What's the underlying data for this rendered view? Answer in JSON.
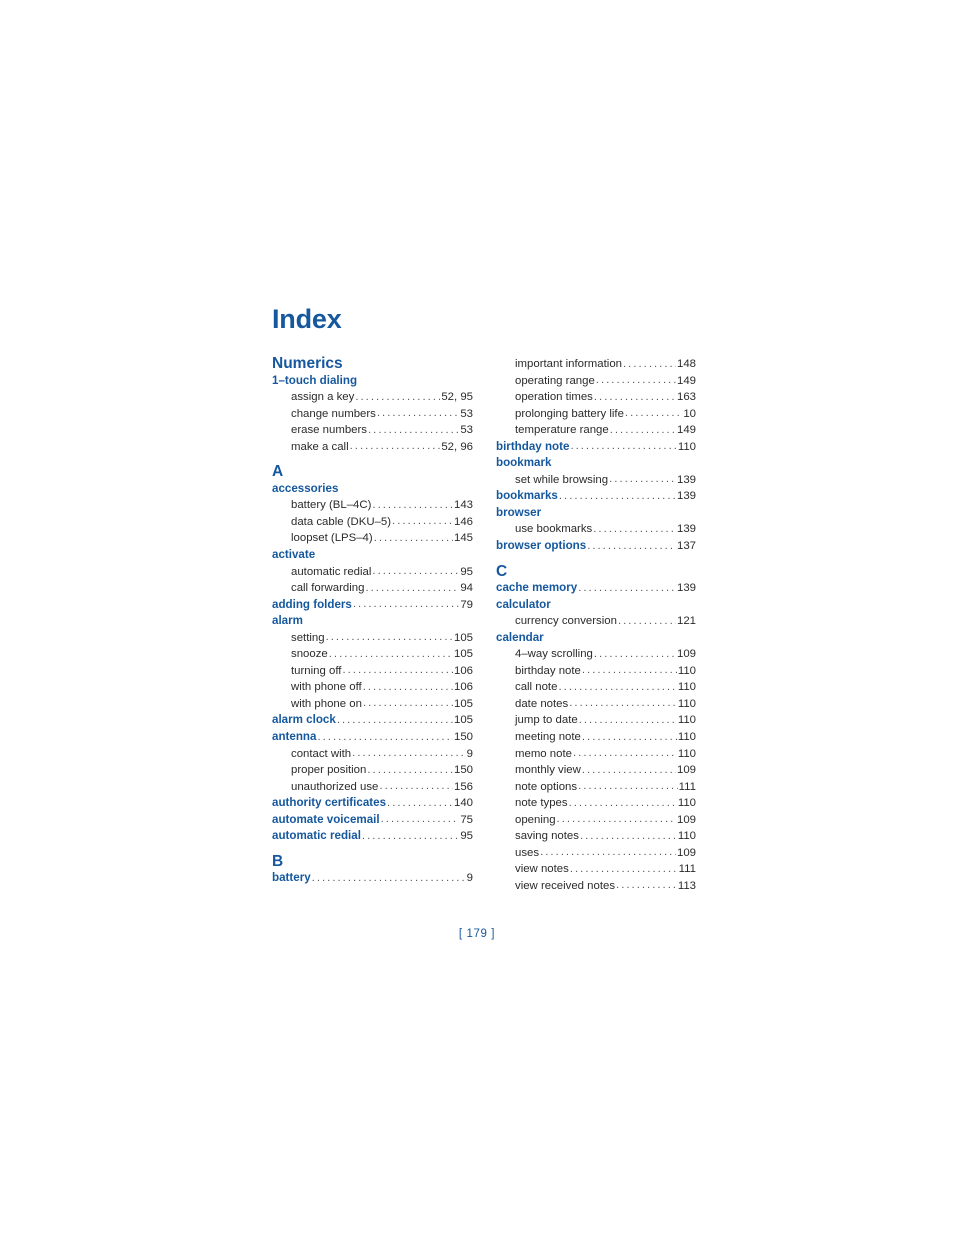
{
  "document": {
    "title": "Index",
    "folio": "[ 179 ]"
  },
  "columns": {
    "left": [
      {
        "type": "letter",
        "label": "Numerics"
      },
      {
        "type": "main",
        "label": "1–touch dialing",
        "page": ""
      },
      {
        "type": "sub",
        "label": "assign a key",
        "page": "52, 95"
      },
      {
        "type": "sub",
        "label": "change numbers",
        "page": "53"
      },
      {
        "type": "sub",
        "label": "erase numbers",
        "page": "53"
      },
      {
        "type": "sub",
        "label": "make a call",
        "page": "52, 96"
      },
      {
        "type": "letter",
        "label": "A"
      },
      {
        "type": "main",
        "label": "accessories",
        "page": ""
      },
      {
        "type": "sub",
        "label": "battery (BL–4C)",
        "page": "143"
      },
      {
        "type": "sub",
        "label": "data cable (DKU–5)",
        "page": "146"
      },
      {
        "type": "sub",
        "label": "loopset (LPS–4)",
        "page": "145"
      },
      {
        "type": "main",
        "label": "activate",
        "page": ""
      },
      {
        "type": "sub",
        "label": "automatic redial",
        "page": "95"
      },
      {
        "type": "sub",
        "label": "call forwarding",
        "page": "94"
      },
      {
        "type": "main",
        "label": "adding folders",
        "page": "79"
      },
      {
        "type": "main",
        "label": "alarm",
        "page": ""
      },
      {
        "type": "sub",
        "label": "setting",
        "page": "105"
      },
      {
        "type": "sub",
        "label": "snooze",
        "page": "105"
      },
      {
        "type": "sub",
        "label": "turning off",
        "page": "106"
      },
      {
        "type": "sub",
        "label": "with phone off",
        "page": "106"
      },
      {
        "type": "sub",
        "label": "with phone on",
        "page": "105"
      },
      {
        "type": "main",
        "label": "alarm clock",
        "page": "105"
      },
      {
        "type": "main",
        "label": "antenna",
        "page": "150"
      },
      {
        "type": "sub",
        "label": "contact with",
        "page": "9"
      },
      {
        "type": "sub",
        "label": "proper position",
        "page": "150"
      },
      {
        "type": "sub",
        "label": "unauthorized use",
        "page": "156"
      },
      {
        "type": "main",
        "label": "authority certificates",
        "page": "140"
      },
      {
        "type": "main",
        "label": "automate voicemail",
        "page": "75"
      },
      {
        "type": "main",
        "label": "automatic redial",
        "page": "95"
      },
      {
        "type": "letter",
        "label": "B"
      },
      {
        "type": "main",
        "label": "battery",
        "page": "9"
      }
    ],
    "right": [
      {
        "type": "sub",
        "label": "important information",
        "page": "148"
      },
      {
        "type": "sub",
        "label": "operating range",
        "page": "149"
      },
      {
        "type": "sub",
        "label": "operation times",
        "page": "163"
      },
      {
        "type": "sub",
        "label": "prolonging battery life",
        "page": "10"
      },
      {
        "type": "sub",
        "label": "temperature range",
        "page": "149"
      },
      {
        "type": "main",
        "label": "birthday note",
        "page": "110"
      },
      {
        "type": "main",
        "label": "bookmark",
        "page": ""
      },
      {
        "type": "sub",
        "label": "set while browsing",
        "page": "139"
      },
      {
        "type": "main",
        "label": "bookmarks",
        "page": "139"
      },
      {
        "type": "main",
        "label": "browser",
        "page": ""
      },
      {
        "type": "sub",
        "label": "use bookmarks",
        "page": "139"
      },
      {
        "type": "main",
        "label": "browser options",
        "page": "137"
      },
      {
        "type": "letter",
        "label": "C"
      },
      {
        "type": "main",
        "label": "cache memory",
        "page": "139"
      },
      {
        "type": "main",
        "label": "calculator",
        "page": ""
      },
      {
        "type": "sub",
        "label": "currency conversion",
        "page": "121"
      },
      {
        "type": "main",
        "label": "calendar",
        "page": ""
      },
      {
        "type": "sub",
        "label": "4–way scrolling",
        "page": "109"
      },
      {
        "type": "sub",
        "label": "birthday note",
        "page": "110"
      },
      {
        "type": "sub",
        "label": "call note",
        "page": "110"
      },
      {
        "type": "sub",
        "label": "date notes",
        "page": "110"
      },
      {
        "type": "sub",
        "label": "jump to date",
        "page": "110"
      },
      {
        "type": "sub",
        "label": "meeting note",
        "page": "110"
      },
      {
        "type": "sub",
        "label": "memo note",
        "page": "110"
      },
      {
        "type": "sub",
        "label": "monthly view",
        "page": "109"
      },
      {
        "type": "sub",
        "label": "note options",
        "page": "111"
      },
      {
        "type": "sub",
        "label": "note types",
        "page": "110"
      },
      {
        "type": "sub",
        "label": "opening",
        "page": "109"
      },
      {
        "type": "sub",
        "label": "saving notes",
        "page": "110"
      },
      {
        "type": "sub",
        "label": "uses",
        "page": "109"
      },
      {
        "type": "sub",
        "label": "view notes",
        "page": "111"
      },
      {
        "type": "sub",
        "label": "view received notes",
        "page": "113"
      }
    ]
  },
  "colors": {
    "heading_blue": "#16589e",
    "body_text": "#2b2b2b",
    "leader_dots": "#555555",
    "page_background": "#ffffff"
  }
}
